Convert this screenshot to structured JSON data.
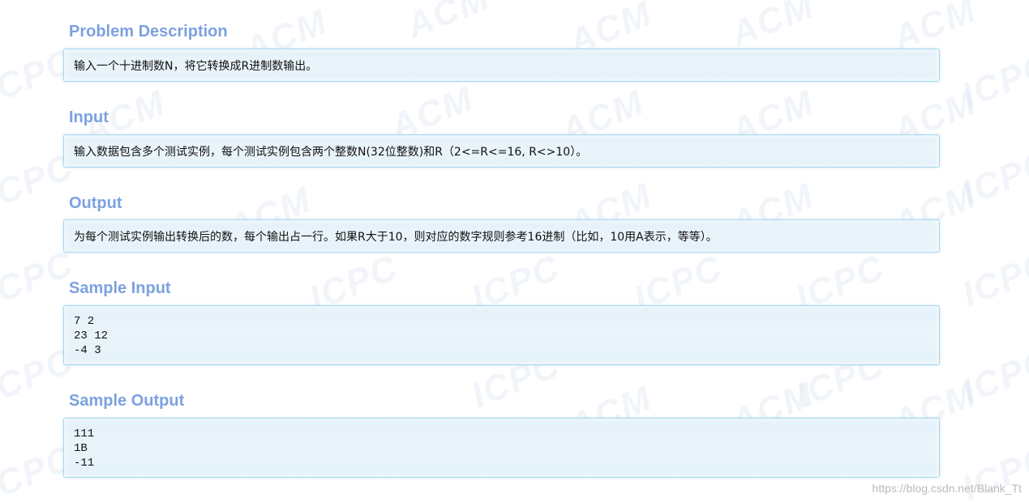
{
  "watermark": {
    "texts": [
      "ACM",
      "ICPC"
    ]
  },
  "sections": {
    "problem_description": {
      "title": "Problem Description",
      "text": "输入一个十进制数N，将它转换成R进制数输出。"
    },
    "input": {
      "title": "Input",
      "text": "输入数据包含多个测试实例，每个测试实例包含两个整数N(32位整数)和R（2<=R<=16, R<>10）。"
    },
    "output": {
      "title": "Output",
      "text": "为每个测试实例输出转换后的数，每个输出占一行。如果R大于10，则对应的数字规则参考16进制（比如，10用A表示，等等）。"
    },
    "sample_input": {
      "title": "Sample Input",
      "text": "7 2\n23 12\n-4 3"
    },
    "sample_output": {
      "title": "Sample Output",
      "text": "111\n1B\n-11"
    }
  },
  "footer": {
    "source_url": "https://blog.csdn.net/Blank_Tt"
  },
  "colors": {
    "title": "#7ca1e0",
    "panel_border": "#a8d8ef",
    "panel_bg": "#e4f1f9"
  }
}
